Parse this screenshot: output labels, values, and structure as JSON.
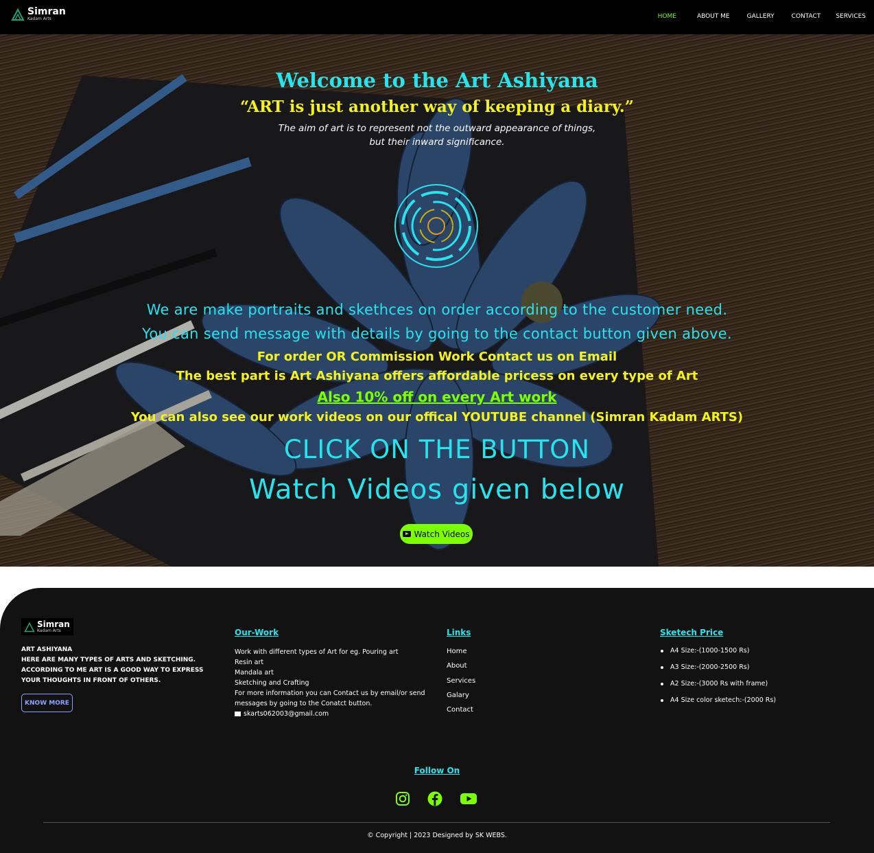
{
  "nav": {
    "brand_name": "Simran",
    "brand_sub": "Kadam Arts",
    "items": [
      {
        "label": "HOME",
        "active": true
      },
      {
        "label": "ABOUT ME",
        "active": false
      },
      {
        "label": "GALLERY",
        "active": false
      },
      {
        "label": "CONTACT",
        "active": false
      },
      {
        "label": "SERVICES",
        "active": false
      }
    ]
  },
  "hero": {
    "title": "Welcome to the Art Ashiyana",
    "quote": "“ART is just another way of keeping a diary.”",
    "tagline_1": "The aim of art is to represent not the outward appearance of things,",
    "tagline_2": "but their inward significance.",
    "line_1": "We are make portraits and skethces on order according to the customer need.",
    "line_2": "You can send message with details by going to the contact button given above.",
    "order_line": "For order OR Commission Work Contact us on Email",
    "price_line": "The best part is Art Ashiyana offers affordable pricess on every type of Art",
    "offer_line": "Also 10% off on every Art work",
    "youtube_line": "You can also see our work videos on our offical YOUTUBE channel (Simran Kadam ARTS)",
    "click_line": "CLICK ON THE BUTTON",
    "watch_line": "Watch Videos given below",
    "button_label": "Watch Videos"
  },
  "footer": {
    "brand_name": "Simran",
    "brand_sub": "Kadam Arts",
    "about_title": "ART ASHIYANA",
    "about_text": "HERE ARE MANY TYPES OF ARTS AND SKETCHING. ACCORDING TO ME ART IS A GOOD WAY TO EXPRESS YOUR THOUGHTS IN FRONT OF OTHERS.",
    "know_more": "KNOW MORE",
    "work_heading": "Our-Work",
    "work_lines": [
      "Work with different types of Art for eg. Pouring art",
      "Resin art",
      "Mandala art",
      "Sketching and Crafting",
      "For more information you can Contact us by email/or send messages by going to the Conatct button."
    ],
    "email": "skarts062003@gmail.com",
    "links_heading": "Links",
    "links": [
      "Home",
      "About",
      "Services",
      "Galary",
      "Contact"
    ],
    "price_heading": "Sketech Price",
    "prices": [
      "A4 Size:-(1000-1500 Rs)",
      "A3 Size:-(2000-2500 Rs)",
      "A2 Size:-(3000 Rs with frame)",
      "A4 Size color sketech:-(2000 Rs)"
    ],
    "follow_heading": "Follow On",
    "socials": [
      "instagram-icon",
      "facebook-icon",
      "youtube-icon"
    ],
    "copyright": "© Copyright | 2023 Designed by SK WEBS."
  },
  "colors": {
    "accent_cyan": "#27e3ed",
    "accent_yellow": "#f4f21e",
    "accent_green": "#7cff00",
    "footer_bg": "#121212"
  }
}
